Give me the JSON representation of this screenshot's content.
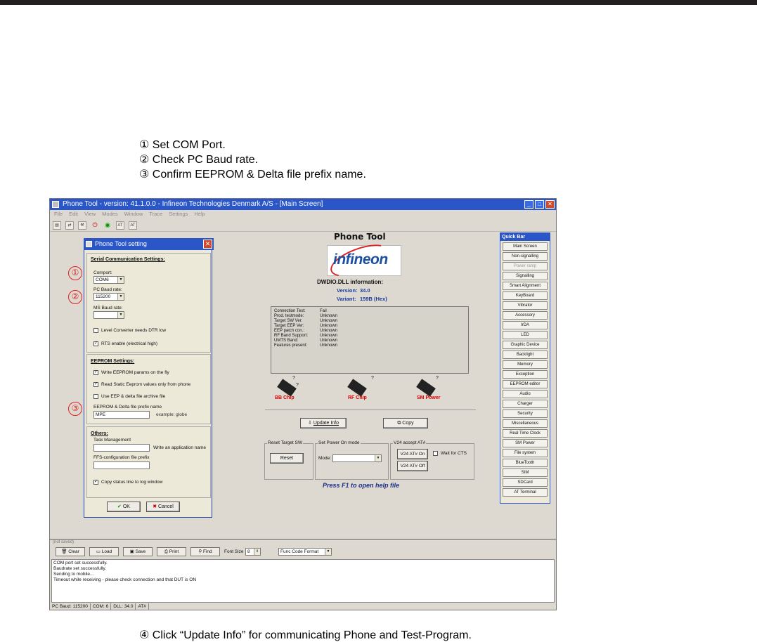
{
  "steps": [
    "① Set COM Port.",
    "② Check PC Baud rate.",
    "③ Confirm EEPROM & Delta file prefix name."
  ],
  "footer_step": "④ Click “Update Info” for communicating Phone and Test-Program.",
  "window": {
    "title": "Phone Tool - version: 41.1.0.0 - Infineon Technologies Denmark A/S - [Main Screen]",
    "menus": [
      "File",
      "Edit",
      "View",
      "Modes",
      "Window",
      "Trace",
      "Settings",
      "Help"
    ]
  },
  "dialog": {
    "title": "Phone Tool setting",
    "serial_heading": "Serial Communication Settings:",
    "comport_label": "Comport:",
    "comport_value": "COM6",
    "pc_baud_label": "PC Baud rate:",
    "pc_baud_value": "115200",
    "ms_baud_label": "MS Baud rate:",
    "ms_baud_value": "",
    "level_converter": "Level Converter needs DTR low",
    "rts_enable": "RTS enable (electrical high)",
    "eeprom_heading": "EEPROM Settings:",
    "write_eeprom": "Write EEPROM params on the fly",
    "read_static": "Read Static Eeprom values only from phone",
    "use_eep": "Use EEP & delta file archive file",
    "prefix_label": "EEPROM & Delta file prefix name",
    "prefix_value": "MPE",
    "prefix_example": "example: globe",
    "others_heading": "Others:",
    "task_mgmt_label": "Task Management",
    "task_mgmt_hint": "Write an application name",
    "ffs_label": "FFS-configuration file prefix",
    "copy_status": "Copy status line to log window",
    "ok": "OK",
    "cancel": "Cancel",
    "markers": [
      "①",
      "②",
      "③"
    ]
  },
  "main": {
    "title": "Phone Tool",
    "logo": "infineon",
    "info_heading": "DWDIO.DLL information:",
    "version_label": "Version:",
    "version_value": "34.0",
    "variant_label": "Variant:",
    "variant_value": "159B (Hex)",
    "info_rows": [
      {
        "k": "Connection Test:",
        "v": "Fail"
      },
      {
        "k": "Prod. testmode:",
        "v": "Unknown"
      },
      {
        "k": "Target SW Ver:",
        "v": "Unknown"
      },
      {
        "k": "Target EEP Ver:",
        "v": "Unknown"
      },
      {
        "k": "EEP patch con.:",
        "v": "Unknown"
      },
      {
        "k": "RF Band Support:",
        "v": "Unknown"
      },
      {
        "k": "UMTS Band:",
        "v": "Unknown"
      },
      {
        "k": "Features present:",
        "v": "Unknown"
      }
    ],
    "chips": [
      "BB Chip",
      "RF Chip",
      "SM Power"
    ],
    "update_info": "Update Info",
    "copy": "Copy",
    "reset_group": "Reset Target SW",
    "reset_btn": "Reset",
    "power_group": "Set Power On mode",
    "mode_label": "Mode:",
    "v24_group": "V24 accept AT#",
    "v24_on": "V24 AT# On",
    "v24_off": "V24 AT# Off",
    "wait_cts": "Wait for CTS",
    "help": "Press F1 to open help file"
  },
  "quickbar": {
    "title": "Quick Bar",
    "items": [
      "Main Screen",
      "Non-signalling",
      "Power ramp",
      "Signalling",
      "Smart Alignment",
      "KeyBoard",
      "Vibrator",
      "Accessory",
      "IrDA",
      "LED",
      "Graphic Device",
      "Backlight",
      "Memory",
      "Exception",
      "EEPROM editor",
      "Audio",
      "Charger",
      "Security",
      "Miscellaneous",
      "Real Time Clock",
      "SM Power",
      "File system",
      "BlueTooth",
      "SIM",
      "SDCard",
      "AT Terminal"
    ]
  },
  "log": {
    "title": "(not saved)",
    "buttons": [
      "Clear",
      "Load",
      "Save",
      "Print",
      "Find"
    ],
    "font_size_label": "Font Size",
    "font_size_value": "8",
    "format": "Func Code Format",
    "lines": [
      "COM port set successfully.",
      "Baudrate set successfully.",
      "Sending to mobile...",
      "Timeout while receiving - please check connection and that DUT is ON"
    ]
  },
  "status": [
    "PC Baud: 115200",
    "COM: 6",
    "DLL: 34.0",
    "AT#"
  ]
}
